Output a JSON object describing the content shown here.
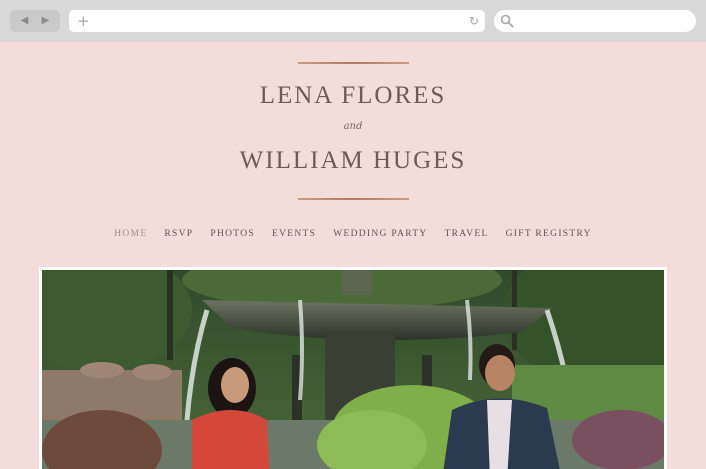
{
  "browser": {
    "back_icon": "◀",
    "forward_icon": "▶",
    "new_tab_icon": "+",
    "reload_icon": "↻"
  },
  "site": {
    "partner_one": "LENA FLORES",
    "conjunction": "and",
    "partner_two": "WILLIAM HUGES"
  },
  "nav": {
    "items": [
      "HOME",
      "RSVP",
      "PHOTOS",
      "EVENTS",
      "WEDDING PARTY",
      "TRAVEL",
      "GIFT REGISTRY"
    ],
    "active_index": 0
  },
  "colors": {
    "page_background": "#f3dcd9",
    "accent_rule": "#b07a66",
    "heading_text": "#6f5a57"
  }
}
